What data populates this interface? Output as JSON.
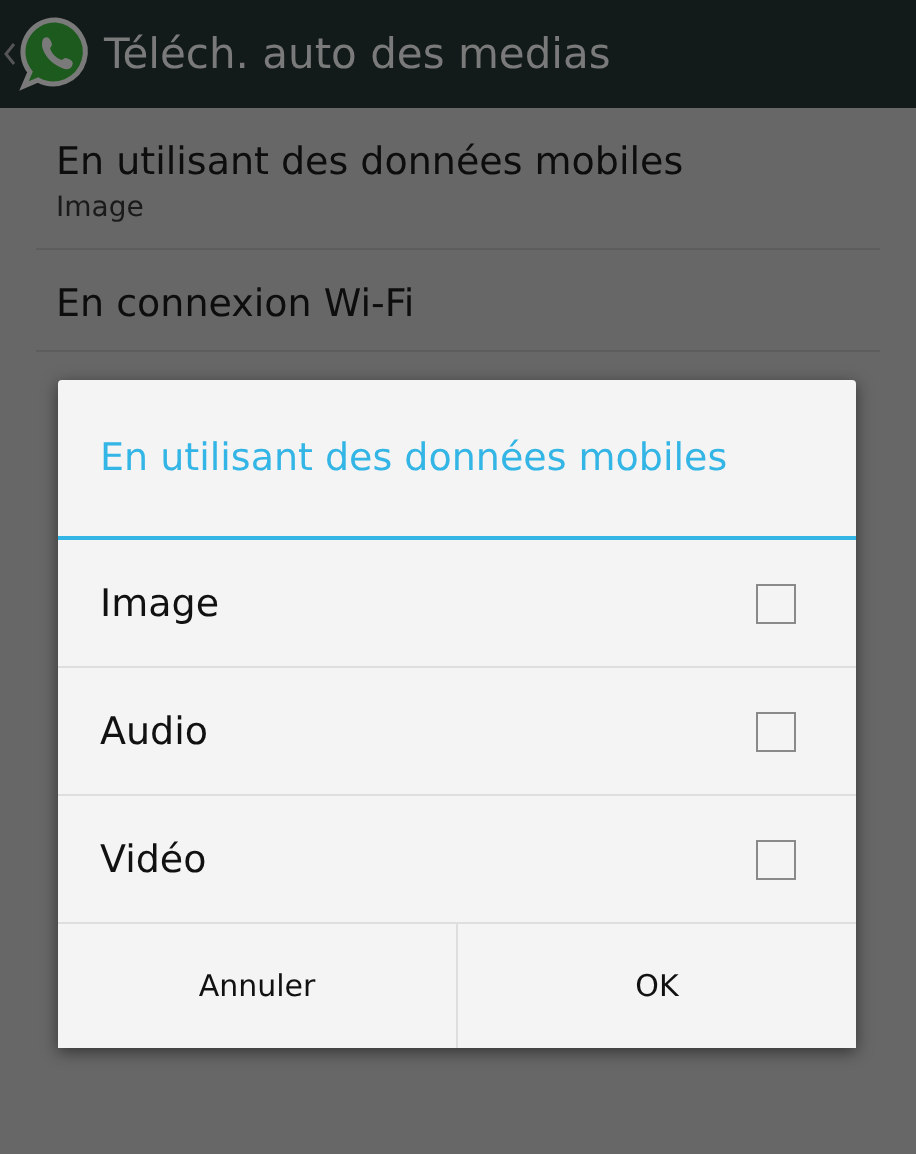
{
  "action_bar": {
    "title": "Téléch. auto des medias"
  },
  "settings": [
    {
      "title": "En utilisant des données mobiles",
      "summary": "Image"
    },
    {
      "title": "En connexion Wi-Fi"
    }
  ],
  "dialog": {
    "title": "En utilisant des données mobiles",
    "options": [
      {
        "label": "Image",
        "checked": false
      },
      {
        "label": "Audio",
        "checked": false
      },
      {
        "label": "Vidéo",
        "checked": false
      }
    ],
    "buttons": [
      "Annuler",
      "OK"
    ]
  }
}
